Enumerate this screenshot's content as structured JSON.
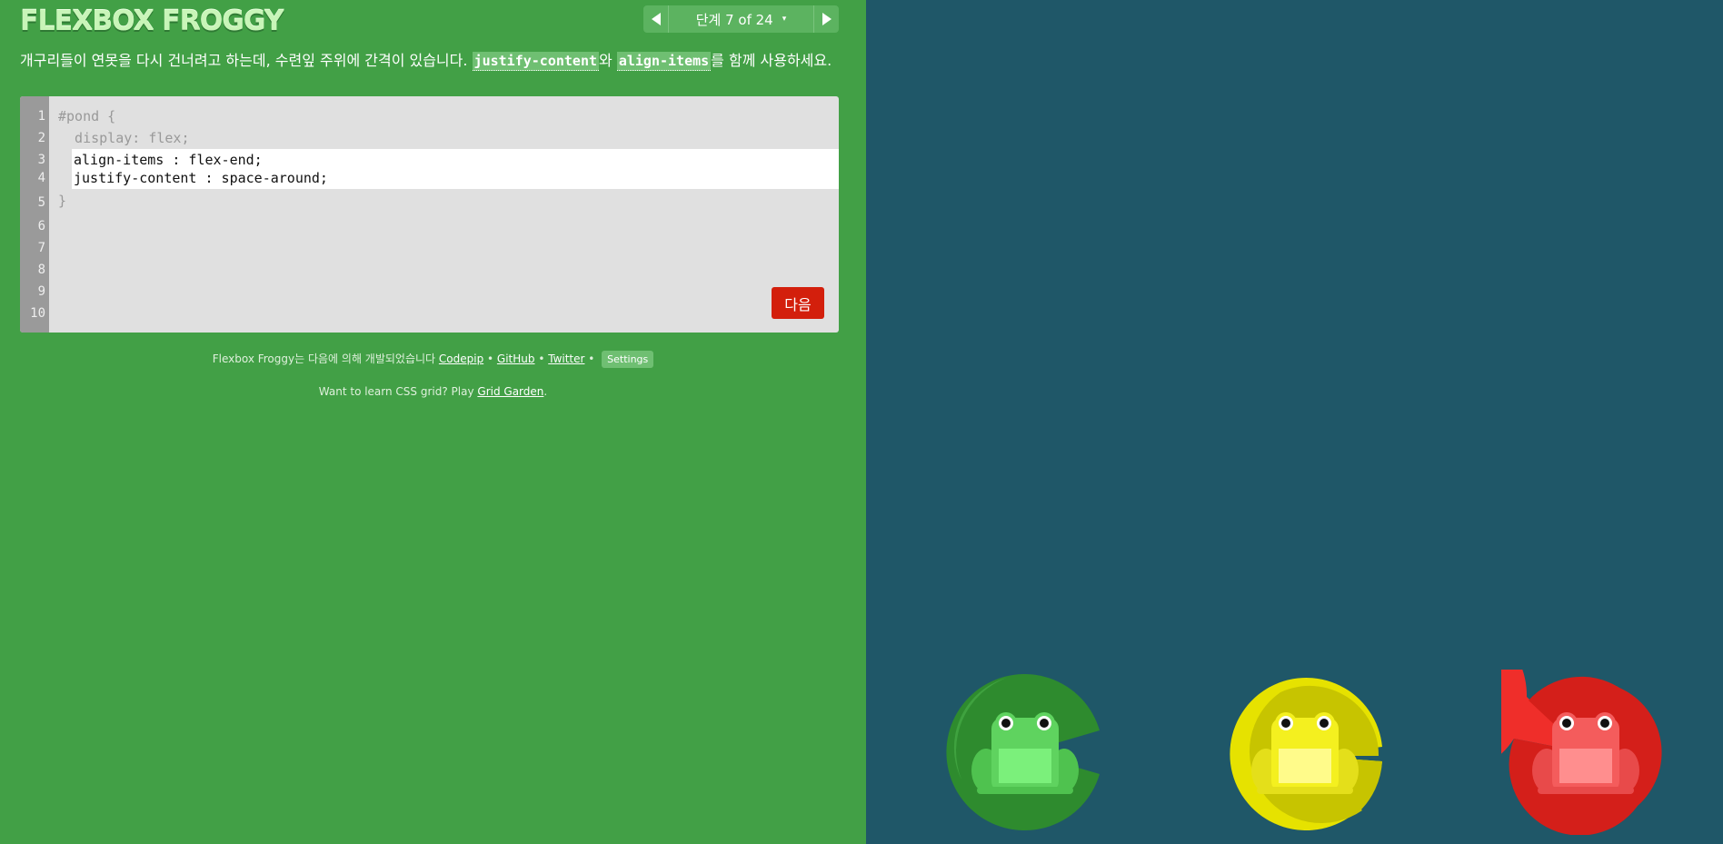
{
  "header": {
    "logo": "FLEXBOX FROGGY",
    "level_label": "단계 7 of 24",
    "caret": "▾"
  },
  "instructions": {
    "part1": "개구리들이 연못을 다시 건너려고 하는데, 수련잎 주위에 간격이 있습니다. ",
    "kw1": "justify-content",
    "part2": "와 ",
    "kw2": "align-items",
    "part3": "를 함께 사용하세요."
  },
  "editor": {
    "line_numbers": [
      "1",
      "2",
      "3",
      "4",
      "5",
      "6",
      "7",
      "8",
      "9",
      "10"
    ],
    "open": "#pond {",
    "display": "  display: flex;",
    "input_lines": [
      "align-items : flex-end;",
      "justify-content : space-around;"
    ],
    "close": "}",
    "next_label": "다음"
  },
  "footer": {
    "credits_prefix": "Flexbox Froggy는 다음에 의해 개발되었습니다 ",
    "codepip": "Codepip",
    "sep": " • ",
    "github": "GitHub",
    "twitter": "Twitter",
    "settings": "Settings",
    "learn_prefix": "Want to learn CSS grid? Play ",
    "grid_garden": "Grid Garden",
    "learn_suffix": "."
  },
  "board": {
    "pads": [
      "green",
      "yellow",
      "red"
    ],
    "frogs": [
      "green",
      "yellow",
      "red"
    ]
  },
  "colors": {
    "sidebar": "#42a046",
    "board": "#1f5768",
    "next_button": "#d31f0c",
    "green_pad": "#2e8b2e",
    "yellow_pad": "#c7c400",
    "red_pad": "#d41f1a",
    "green_frog": "#5fd35f",
    "yellow_frog": "#f4f01f",
    "red_frog": "#f45c5c"
  }
}
